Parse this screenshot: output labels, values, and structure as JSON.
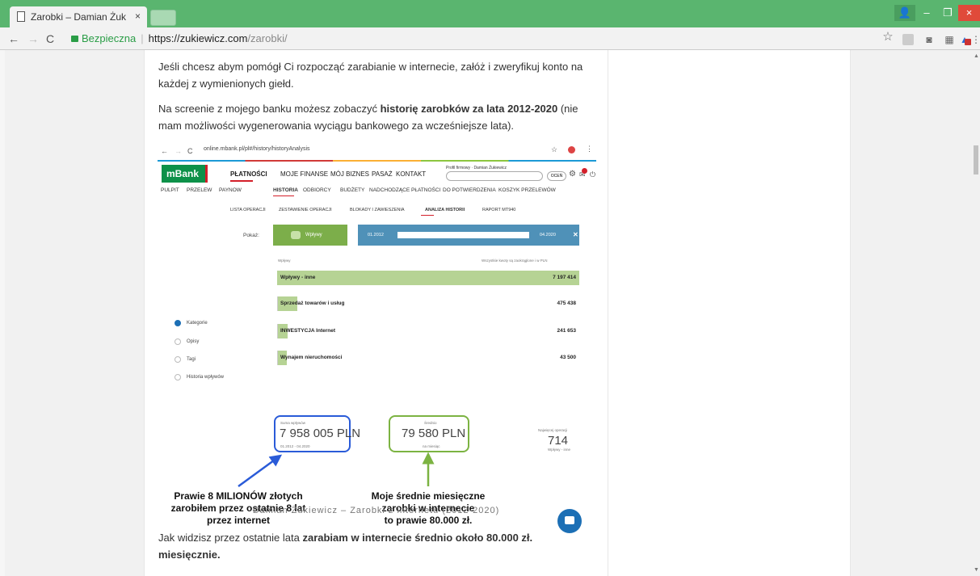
{
  "browser": {
    "tab_title": "Zarobki – Damian Żukiew",
    "tab_close": "×",
    "secure_label": "Bezpieczna",
    "url_host": "https://zukiewicz.com",
    "url_path": "/zarobki/",
    "window": {
      "minimize": "–",
      "maximize": "❐",
      "close": "×",
      "user": "👤"
    },
    "nav": {
      "back": "←",
      "forward": "→",
      "reload": "C"
    },
    "icons": {
      "star": "☆",
      "menu": "⋮"
    }
  },
  "article": {
    "p1_before": "Jeśli chcesz abym pomógł Ci rozpocząć zarabianie w internecie, załóż i zweryfikuj konto na każdej z wymienionych giełd.",
    "p2_before": "Na screenie z mojego banku możesz zobaczyć ",
    "p2_bold": "historię zarobków za lata 2012-2020",
    "p2_after": " (nie mam możliwości wygenerowania wyciągu bankowego za wcześniejsze lata).",
    "caption": "Damian Żukiewicz – Zarobki z internetu (2012-2020)",
    "p3_before": "Jak widzisz przez ostatnie lata ",
    "p3_bold": "zarabiam w internecie średnio około 80.000 zł. miesięcznie."
  },
  "bank": {
    "url": "online.mbank.pl/pl#/history/historyAnalysis",
    "logo": "mBank",
    "main_nav": [
      "PŁATNOŚCI",
      "MOJE FINANSE",
      "MÓJ BIZNES",
      "PASAŻ",
      "KONTAKT"
    ],
    "profile_label": "Profil firmowy · Damian Żukiewicz",
    "ocen": "OCEŃ",
    "sub_nav": [
      "PULPIT",
      "PRZELEW",
      "PAYNOW",
      "HISTORIA",
      "ODBIORCY",
      "BUDŻETY",
      "NADCHODZĄCE PŁATNOŚCI",
      "DO POTWIERDZENIA",
      "KOSZYK PRZELEWÓW"
    ],
    "tabs": [
      "LISTA OPERACJI",
      "ZESTAWIENIE OPERACJI",
      "BLOKADY I ZAWIESZENIA",
      "ANALIZA HISTORII",
      "RAPORT MT940"
    ],
    "pokaz": "Pokaż:",
    "wplywy_btn": "Wpływy",
    "date_from": "01.2012",
    "date_to": "04.2020",
    "range_close": "✕",
    "radios": [
      "Kategorie",
      "Opisy",
      "Tagi",
      "Historia wpływów"
    ],
    "list_caption": "Wpływy",
    "list_note": "Wszystkie kwoty są zaokrąglone i w PLN",
    "bars": [
      {
        "label": "Wpływy - inne",
        "value": "7 197 414",
        "amount": 7197414
      },
      {
        "label": "Sprzedaż towarów i usług",
        "value": "475 438",
        "amount": 475438
      },
      {
        "label": "INWESTYCJA Internet",
        "value": "241 653",
        "amount": 241653
      },
      {
        "label": "Wynajem nieruchomości",
        "value": "43 500",
        "amount": 43500
      }
    ],
    "sum": {
      "caption": "Suma wpływów",
      "value": "7 958 005 PLN",
      "range": "01.2012 - 04.2020"
    },
    "avg": {
      "caption": "Średnio",
      "value": "79 580 PLN",
      "sub": "na miesiąc"
    },
    "ops": {
      "caption": "Najwięcej operacji",
      "value": "714",
      "sub": "Wpływy - inne"
    },
    "annotation_left": [
      "Prawie 8 MILIONÓW złotych",
      "zarobiłem przez ostatnie 8 lat",
      "przez internet"
    ],
    "annotation_right": [
      "Moje średnie miesięczne",
      "zarobki w internecie",
      "to prawie 80.000 zł."
    ]
  }
}
